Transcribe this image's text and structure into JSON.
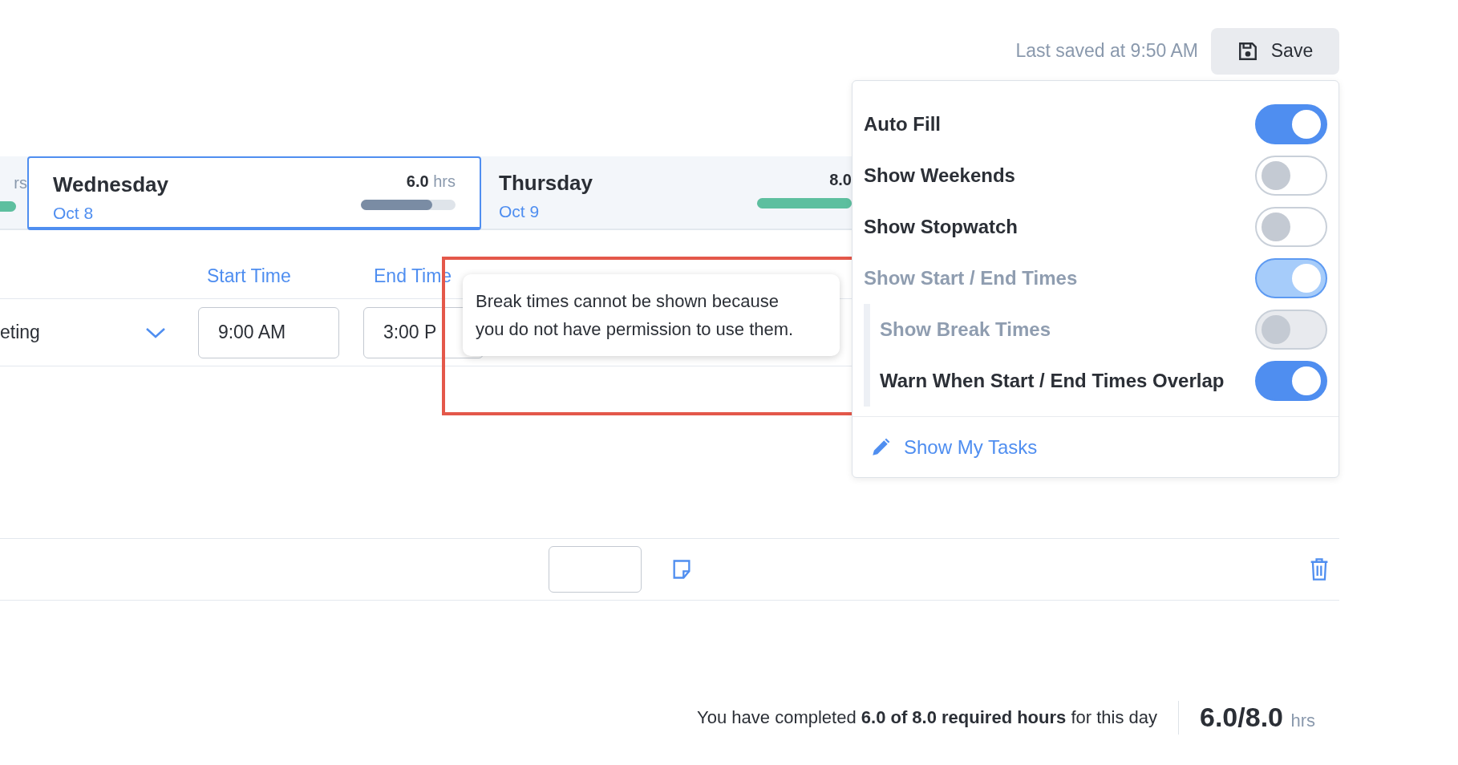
{
  "header": {
    "last_saved": "Last saved at 9:50 AM",
    "save_button": "Save"
  },
  "days": [
    {
      "unit": "rs",
      "level": 1,
      "selected": false
    },
    {
      "name": "Wednesday",
      "date": "Oct 8",
      "hours": "6.0",
      "unit": "hrs",
      "level": 0.75,
      "selected": true
    },
    {
      "name": "Thursday",
      "date": "Oct 9",
      "hours": "8.0",
      "level": 1,
      "selected": false
    }
  ],
  "columns": [
    "Start Time",
    "End Time"
  ],
  "entries": [
    {
      "task": "eting",
      "start": "9:00 AM",
      "end": "3:00 P"
    }
  ],
  "tooltip": {
    "text": "Break times cannot be shown because you do not have permission to use them."
  },
  "settings": {
    "toggles": [
      {
        "label": "Auto Fill",
        "on": true,
        "disabled": false
      },
      {
        "label": "Show Weekends",
        "on": false,
        "disabled": false
      },
      {
        "label": "Show Stopwatch",
        "on": false,
        "disabled": false
      },
      {
        "label": "Show Start / End Times",
        "on": true,
        "disabled": true,
        "children": [
          {
            "label": "Show Break Times",
            "on": false,
            "disabled": true
          },
          {
            "label": "Warn When Start / End Times Overlap",
            "on": true,
            "disabled": false
          }
        ]
      }
    ],
    "link": "Show My Tasks"
  },
  "summary": {
    "text": "You have completed **6.0 of 8.0 required hours** for this day",
    "total": "6.0/8.0",
    "unit": "hrs"
  }
}
